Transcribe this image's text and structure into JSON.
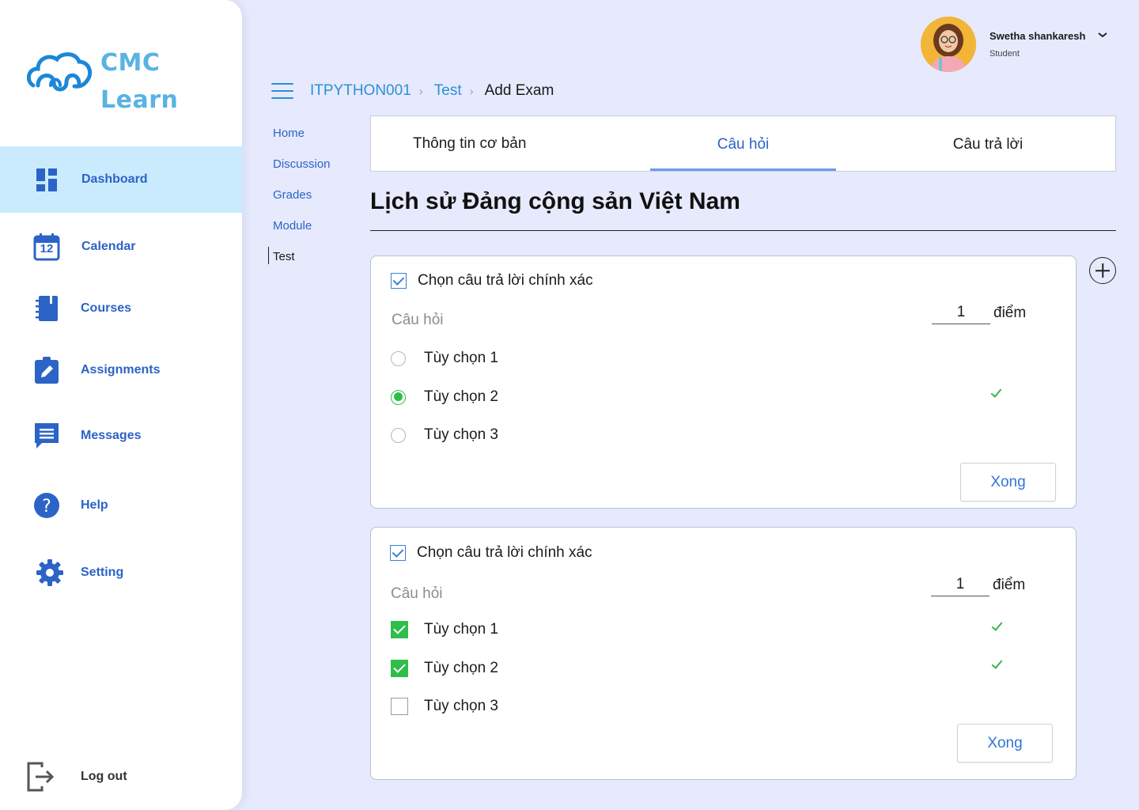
{
  "app": {
    "brand_line1": "CMC",
    "brand_line2": "Learn"
  },
  "sidebar": {
    "items": [
      {
        "label": "Dashboard",
        "icon": "dashboard-icon",
        "active": true
      },
      {
        "label": "Calendar",
        "icon": "calendar-icon",
        "calendar_day": "12"
      },
      {
        "label": "Courses",
        "icon": "notebook-icon"
      },
      {
        "label": "Assignments",
        "icon": "clipboard-edit-icon"
      },
      {
        "label": "Messages",
        "icon": "message-icon"
      },
      {
        "label": "Help",
        "icon": "help-icon"
      },
      {
        "label": "Setting",
        "icon": "gear-icon"
      }
    ],
    "logout_label": "Log out"
  },
  "user": {
    "name": "Swetha shankaresh",
    "role": "Student"
  },
  "breadcrumb": {
    "course": "ITPYTHON001",
    "section": "Test",
    "current": "Add Exam"
  },
  "subnav": {
    "items": [
      "Home",
      "Discussion",
      "Grades",
      "Module",
      "Test"
    ],
    "current": "Test"
  },
  "tabs": [
    {
      "label": "Thông tin cơ bản"
    },
    {
      "label": "Câu hỏi",
      "active": true
    },
    {
      "label": "Câu trả lời"
    }
  ],
  "exam": {
    "title": "Lịch sử Đảng cộng sản Việt Nam"
  },
  "questions": [
    {
      "type_label": "Chọn câu trả lời chính xác",
      "placeholder": "Câu hỏi",
      "score": "1",
      "score_unit": "điểm",
      "input_kind": "radio",
      "options": [
        {
          "label": "Tùy chọn 1",
          "selected": false
        },
        {
          "label": "Tùy chọn 2",
          "selected": true
        },
        {
          "label": "Tùy chọn 3",
          "selected": false
        }
      ],
      "done_label": "Xong"
    },
    {
      "type_label": "Chọn câu trả lời chính xác",
      "placeholder": "Câu hỏi",
      "score": "1",
      "score_unit": "điểm",
      "input_kind": "checkbox",
      "options": [
        {
          "label": "Tùy chọn 1",
          "selected": true
        },
        {
          "label": "Tùy chọn 2",
          "selected": true
        },
        {
          "label": "Tùy chọn 3",
          "selected": false
        }
      ],
      "done_label": "Xong"
    }
  ],
  "colors": {
    "background": "#e6eafc",
    "accent": "#2c63c6",
    "link": "#2c8fd8",
    "active_nav": "#c9ebfd",
    "correct": "#2fbd4c",
    "brand": "#59b3e3"
  }
}
